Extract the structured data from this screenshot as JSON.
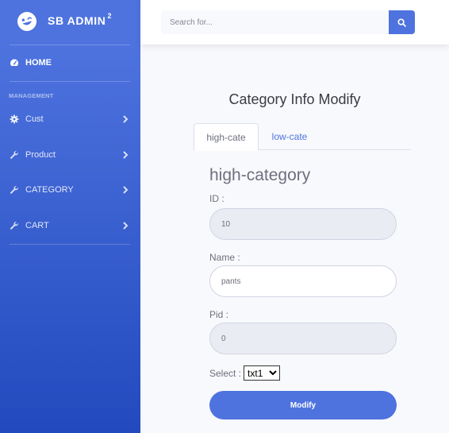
{
  "brand": {
    "name": "SB ADMIN",
    "superscript": "2"
  },
  "sidebar": {
    "home_label": "HOME",
    "section_heading": "MANAGEMENT",
    "items": [
      {
        "label": "Cust",
        "icon": "gear-icon"
      },
      {
        "label": "Product",
        "icon": "wrench-icon"
      },
      {
        "label": "CATEGORY",
        "icon": "wrench-icon"
      },
      {
        "label": "CART",
        "icon": "wrench-icon"
      }
    ]
  },
  "search": {
    "placeholder": "Search for..."
  },
  "page": {
    "title": "Category Info Modify"
  },
  "tabs": [
    {
      "label": "high-cate",
      "active": true
    },
    {
      "label": "low-cate",
      "active": false
    }
  ],
  "form": {
    "heading": "high-category",
    "id_label": "ID :",
    "id_value": "10",
    "name_label": "Name :",
    "name_value": "pants",
    "pid_label": "Pid :",
    "pid_value": "0",
    "select_label": "Select :",
    "select_value": "txt1",
    "submit_label": "Modify"
  },
  "colors": {
    "primary": "#4e73df",
    "sidebar_end": "#224abe",
    "text": "#6e707e",
    "background": "#f8f9fc"
  }
}
